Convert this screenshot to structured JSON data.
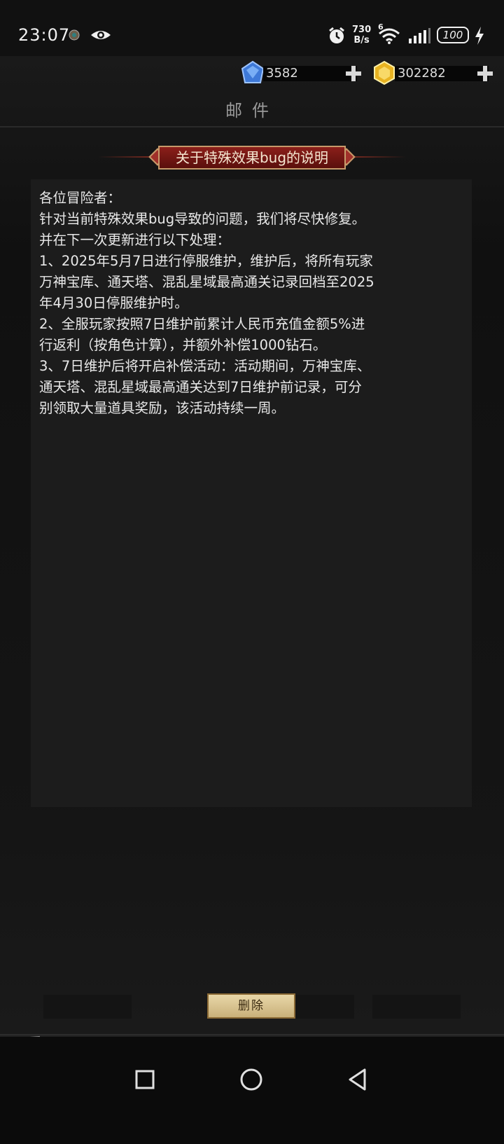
{
  "status": {
    "time": "23:07",
    "net_speed_value": "730",
    "net_speed_unit": "B/s",
    "wifi_label": "6",
    "battery": "100"
  },
  "currency": {
    "gems": "3582",
    "gold": "302282"
  },
  "page": {
    "title": "邮件"
  },
  "mail": {
    "subject": "关于特殊效果bug的说明",
    "body_lines": [
      "各位冒险者：",
      "针对当前特殊效果bug导致的问题，我们将尽快修复。",
      "并在下一次更新进行以下处理：",
      "1、2025年5月7日进行停服维护，维护后，将所有玩家",
      "万神宝库、通天塔、混乱星域最高通关记录回档至2025",
      "年4月30日停服维护时。",
      "2、全服玩家按照7日维护前累计人民币充值金额5%进",
      "行返利（按角色计算），并额外补偿1000钻石。",
      "3、7日维护后将开启补偿活动：活动期间，万神宝库、",
      "通天塔、混乱星域最高通关达到7日维护前记录，可分",
      "别领取大量道具奖励，该活动持续一周。"
    ]
  },
  "actions": {
    "delete": "删除"
  },
  "colors": {
    "accent_red": "#8b1f1a",
    "gold_frame": "#c69a6a",
    "button_gold": "#e8d7a8"
  }
}
